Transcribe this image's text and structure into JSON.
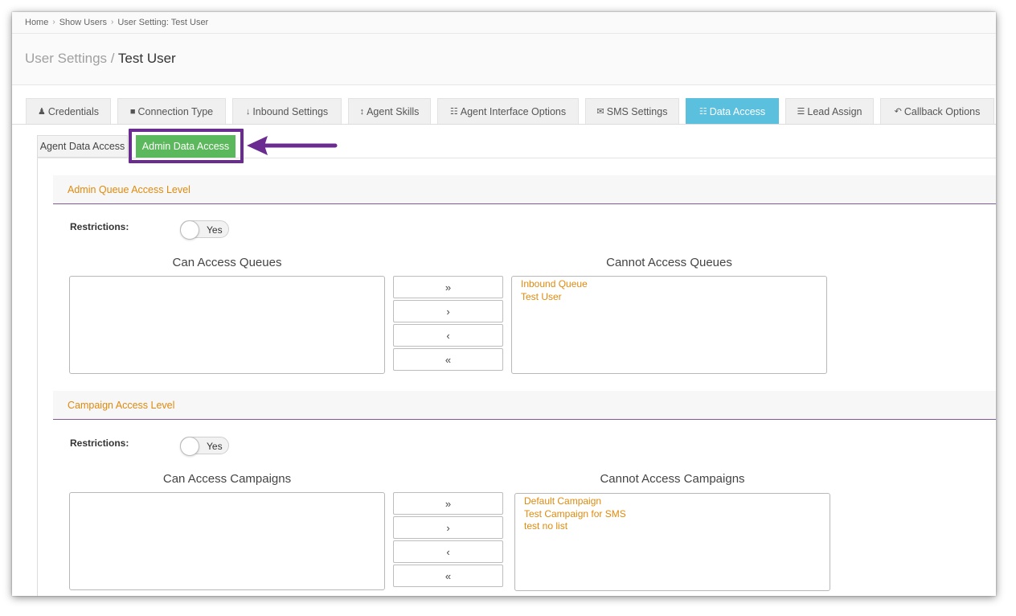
{
  "breadcrumb": {
    "items": [
      {
        "label": "Home"
      },
      {
        "label": "Show Users"
      },
      {
        "label": "User Setting: Test User"
      }
    ],
    "separator": "›"
  },
  "page_title": {
    "prefix": "User Settings /",
    "name": "Test User"
  },
  "tabs": [
    {
      "label": "Credentials",
      "icon": "user-icon",
      "glyph": "♟"
    },
    {
      "label": "Connection Type",
      "icon": "lock-icon",
      "glyph": "■"
    },
    {
      "label": "Inbound Settings",
      "icon": "arrow-down-icon",
      "glyph": "↓"
    },
    {
      "label": "Agent Skills",
      "icon": "arrows-vertical-icon",
      "glyph": "↕"
    },
    {
      "label": "Agent Interface Options",
      "icon": "grid-icon",
      "glyph": "☷"
    },
    {
      "label": "SMS Settings",
      "icon": "envelope-icon",
      "glyph": "✉"
    },
    {
      "label": "Data Access",
      "icon": "table-icon",
      "glyph": "☷",
      "active": true
    },
    {
      "label": "Lead Assign",
      "icon": "list-ol-icon",
      "glyph": "☰"
    },
    {
      "label": "Callback Options",
      "icon": "reply-all-icon",
      "glyph": "↶"
    }
  ],
  "subtabs": {
    "agent": "Agent Data Access",
    "admin": "Admin Data Access"
  },
  "colors": {
    "accent_tab": "#5bc0de",
    "subtab_active": "#5cb85c",
    "annotation": "#6a2c91",
    "option_text": "#e08a0c"
  },
  "queue_section": {
    "title": "Admin Queue Access Level",
    "restrictions_label": "Restrictions:",
    "toggle_label": "Yes",
    "can_title": "Can Access Queues",
    "cannot_title": "Cannot Access Queues",
    "can_items": [],
    "cannot_items": [
      "Inbound Queue",
      "Test User"
    ]
  },
  "campaign_section": {
    "title": "Campaign Access Level",
    "restrictions_label": "Restrictions:",
    "toggle_label": "Yes",
    "can_title": "Can Access Campaigns",
    "cannot_title": "Cannot Access Campaigns",
    "can_items": [],
    "cannot_items": [
      "Default Campaign",
      "Test Campaign for SMS",
      "test no list"
    ]
  },
  "move_buttons": {
    "move_all_right": "»",
    "move_right": "›",
    "move_left": "‹",
    "move_all_left": "«"
  }
}
